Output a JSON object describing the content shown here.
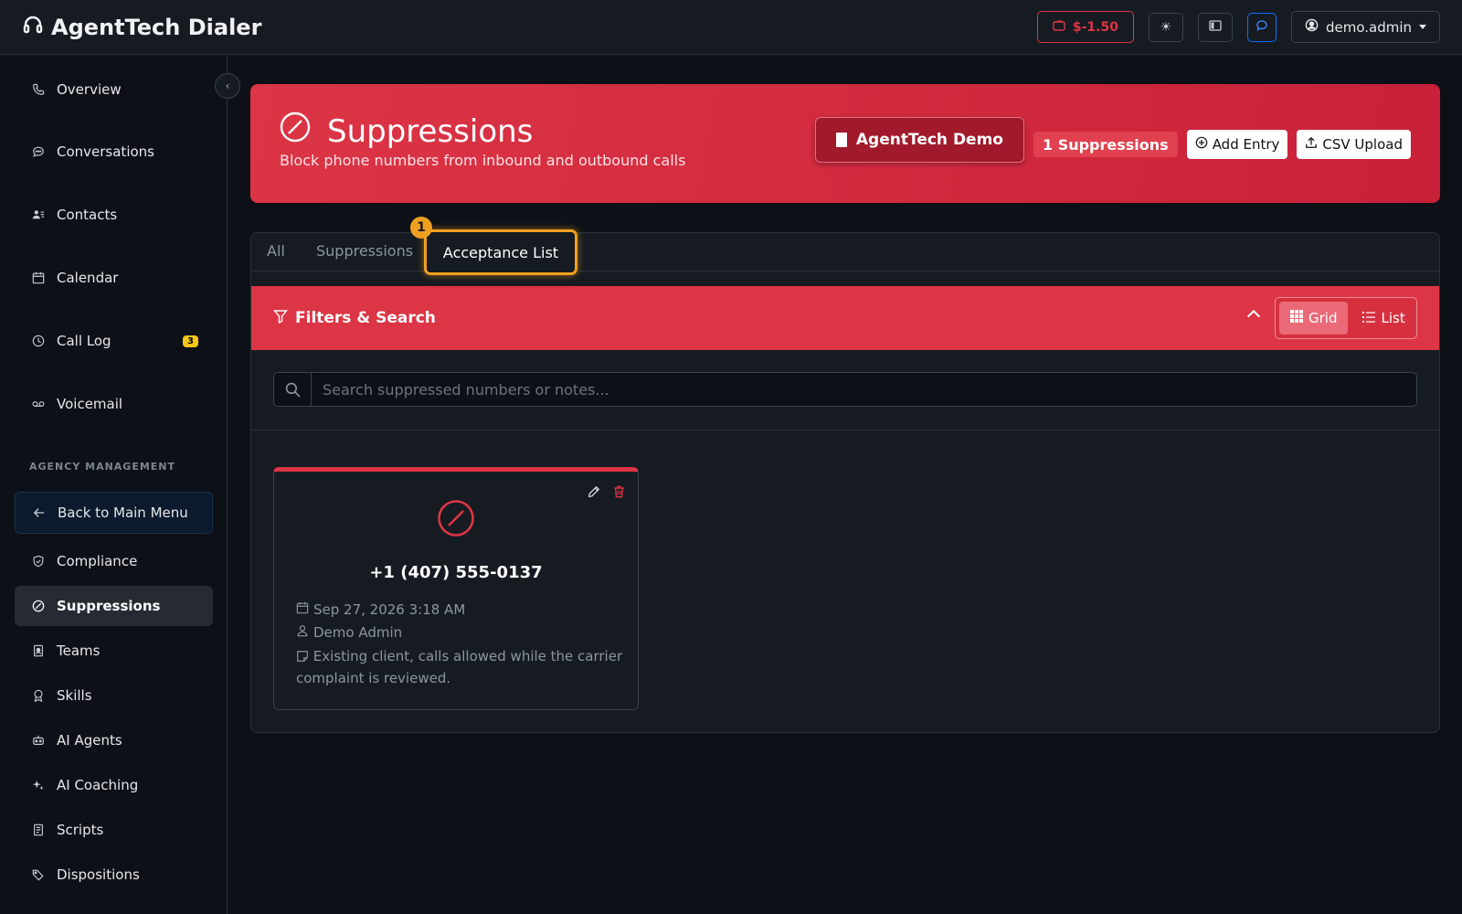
{
  "app": {
    "title": "AgentTech Dialer"
  },
  "topbar": {
    "balance": "$-1.50",
    "user": "demo.admin"
  },
  "sidebar": {
    "items": [
      {
        "label": "Overview",
        "icon": "phone-icon"
      },
      {
        "label": "Conversations",
        "icon": "chat-icon"
      },
      {
        "label": "Contacts",
        "icon": "contacts-icon"
      },
      {
        "label": "Calendar",
        "icon": "calendar-icon"
      },
      {
        "label": "Call Log",
        "icon": "clock-icon",
        "badge": "3"
      },
      {
        "label": "Voicemail",
        "icon": "voicemail-icon"
      }
    ],
    "section_label": "AGENCY MANAGEMENT",
    "back_label": "Back to Main Menu",
    "agency_items": [
      {
        "label": "Compliance"
      },
      {
        "label": "Suppressions"
      },
      {
        "label": "Teams"
      },
      {
        "label": "Skills"
      },
      {
        "label": "AI Agents"
      },
      {
        "label": "AI Coaching"
      },
      {
        "label": "Scripts"
      },
      {
        "label": "Dispositions"
      }
    ]
  },
  "banner": {
    "title": "Suppressions",
    "subtitle": "Block phone numbers from inbound and outbound calls",
    "org": "AgentTech Demo",
    "count": "1 Suppressions",
    "add_label": "Add Entry",
    "csv_label": "CSV Upload"
  },
  "tabs": {
    "all": "All",
    "suppressions": "Suppressions",
    "acceptance": "Acceptance List",
    "step": "1"
  },
  "filters": {
    "title": "Filters & Search",
    "grid_label": "Grid",
    "list_label": "List"
  },
  "search": {
    "placeholder": "Search suppressed numbers or notes..."
  },
  "card": {
    "number": "+1 (407) 555-0137",
    "date": "Sep 27, 2026 3:18 AM",
    "user": "Demo Admin",
    "note": "Existing client, calls allowed while the carrier complaint is reviewed."
  },
  "colors": {
    "accent": "#dc3545",
    "highlight": "#f0a020",
    "background": "#0d1117"
  }
}
